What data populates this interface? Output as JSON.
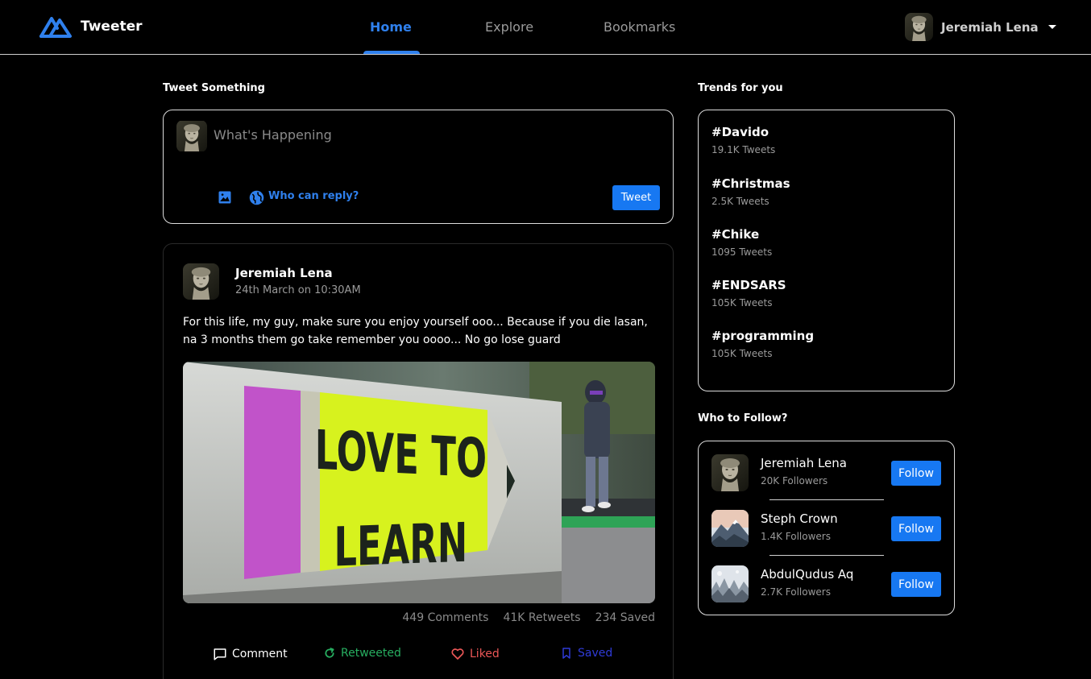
{
  "app": {
    "name": "Tweeter"
  },
  "nav": {
    "home": "Home",
    "explore": "Explore",
    "bookmarks": "Bookmarks"
  },
  "user": {
    "name": "Jeremiah Lena"
  },
  "compose": {
    "title": "Tweet Something",
    "placeholder": "What's Happening",
    "who_can_reply": "Who can reply?",
    "tweet_label": "Tweet"
  },
  "post": {
    "author": "Jeremiah Lena",
    "date": "24th March on 10:30AM",
    "text": "For this life, my guy, make sure you enjoy yourself ooo... Because if you die lasan, na 3 months them go take remember you oooo... No go lose guard",
    "image_text_line1": "LOVE TO",
    "image_text_line2": "LEARN",
    "stats": {
      "comments": "449 Comments",
      "retweets": "41K Retweets",
      "saved": "234 Saved"
    },
    "actions": {
      "comment": "Comment",
      "retweet": "Retweeted",
      "like": "Liked",
      "save": "Saved"
    }
  },
  "trends": {
    "title": "Trends for you",
    "items": [
      {
        "tag": "#Davido",
        "count": "19.1K Tweets"
      },
      {
        "tag": "#Christmas",
        "count": "2.5K Tweets"
      },
      {
        "tag": "#Chike",
        "count": "1095 Tweets"
      },
      {
        "tag": "#ENDSARS",
        "count": "105K Tweets"
      },
      {
        "tag": "#programming",
        "count": "105K Tweets"
      }
    ]
  },
  "follow": {
    "title": "Who to Follow?",
    "button_label": "Follow",
    "people": [
      {
        "name": "Jeremiah Lena",
        "followers": "20K Followers"
      },
      {
        "name": "Steph Crown",
        "followers": "1.4K Followers"
      },
      {
        "name": "AbdulQudus Aq",
        "followers": "2.7K Followers"
      }
    ]
  },
  "colors": {
    "accent": "#2f80ed",
    "button": "#1778f2",
    "retweet": "#27ae60",
    "like": "#eb5757",
    "save": "#2f3bd8"
  },
  "icons": {
    "logo": "tweeter-logo-icon",
    "caret": "caret-down-icon",
    "image": "image-icon",
    "globe": "globe-icon",
    "comment": "comment-icon",
    "retweet": "retweet-icon",
    "like": "heart-icon",
    "save": "bookmark-icon"
  }
}
